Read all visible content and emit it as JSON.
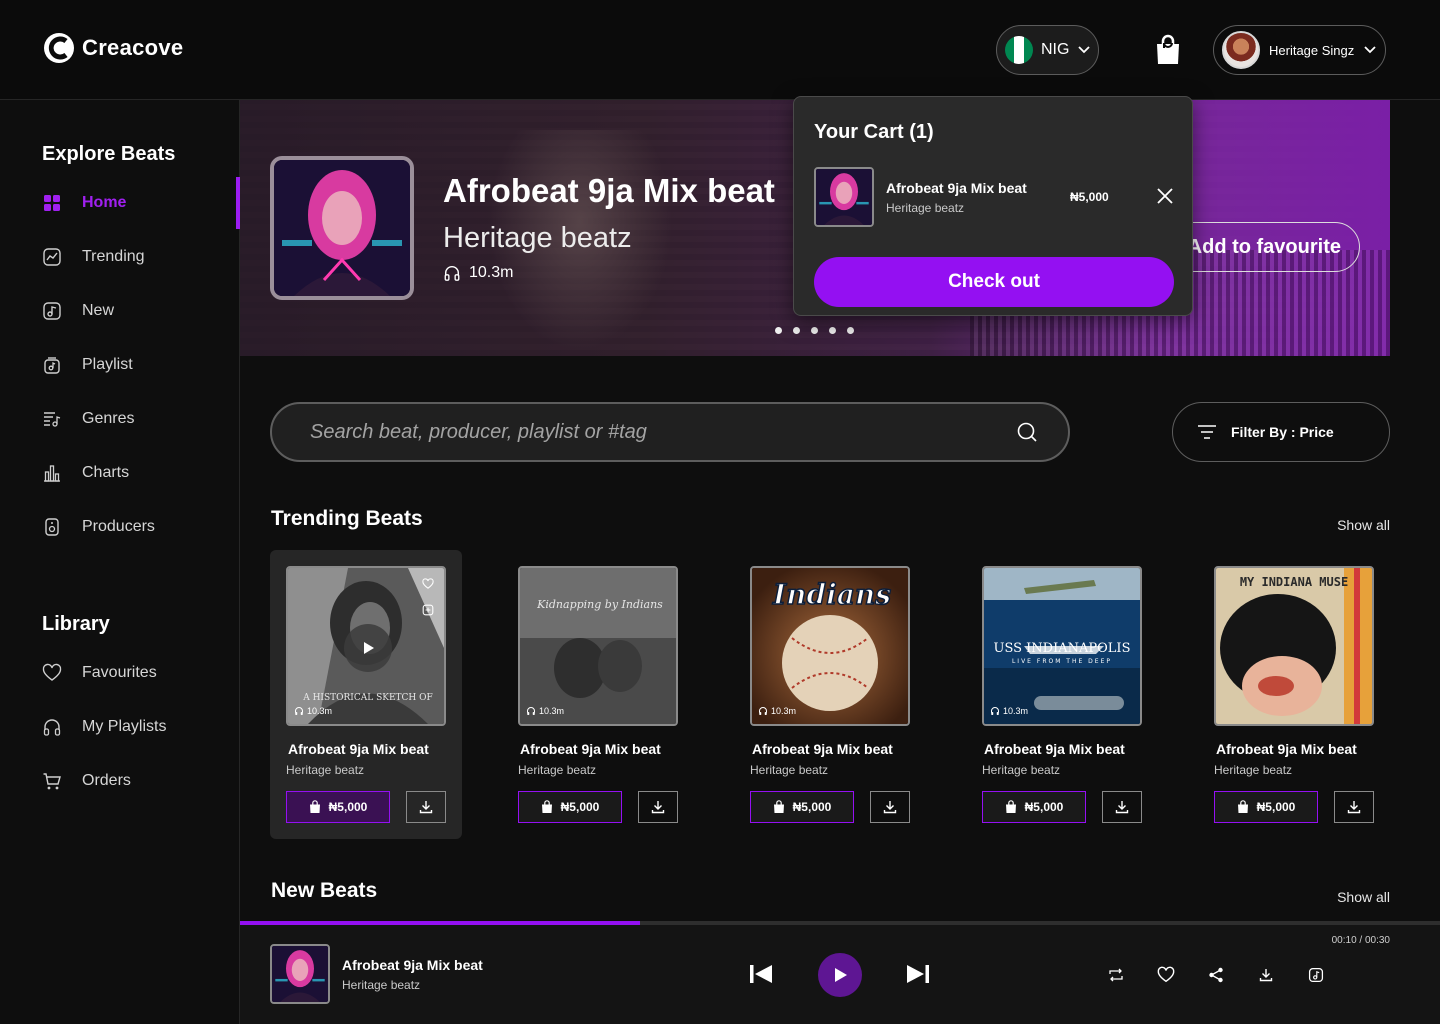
{
  "header": {
    "brand": "Creacove",
    "country": "NIG",
    "user_name": "Heritage Singz"
  },
  "sidebar": {
    "explore_title": "Explore Beats",
    "explore_items": [
      {
        "label": "Home",
        "icon": "grid-icon",
        "active": true
      },
      {
        "label": "Trending",
        "icon": "trending-icon"
      },
      {
        "label": "New",
        "icon": "music-note-icon"
      },
      {
        "label": "Playlist",
        "icon": "playlist-icon"
      },
      {
        "label": "Genres",
        "icon": "genres-icon"
      },
      {
        "label": "Charts",
        "icon": "bar-chart-icon"
      },
      {
        "label": "Producers",
        "icon": "speaker-icon"
      }
    ],
    "library_title": "Library",
    "library_items": [
      {
        "label": "Favourites",
        "icon": "heart-icon"
      },
      {
        "label": "My Playlists",
        "icon": "headphones-icon"
      },
      {
        "label": "Orders",
        "icon": "cart-icon"
      }
    ]
  },
  "hero": {
    "title": "Afrobeat 9ja Mix beat",
    "producer": "Heritage beatz",
    "plays": "10.3m",
    "favourite_label": "Add to favourite",
    "slides": 5
  },
  "cart": {
    "title": "Your Cart (1)",
    "item_title": "Afrobeat 9ja Mix beat",
    "item_producer": "Heritage beatz",
    "item_price": "₦5,000",
    "checkout_label": "Check out"
  },
  "search": {
    "placeholder": "Search beat, producer, playlist or #tag",
    "filter_label": "Filter By : Price"
  },
  "trending": {
    "title": "Trending Beats",
    "show_all": "Show all",
    "cards": [
      {
        "title": "Afrobeat 9ja Mix beat",
        "producer": "Heritage beatz",
        "price": "₦5,000",
        "plays": "10.3m",
        "cover_text": "A HISTORICAL SKETCH OF"
      },
      {
        "title": "Afrobeat 9ja Mix beat",
        "producer": "Heritage beatz",
        "price": "₦5,000",
        "plays": "10.3m",
        "cover_text": "Kidnapping by Indians"
      },
      {
        "title": "Afrobeat 9ja Mix beat",
        "producer": "Heritage beatz",
        "price": "₦5,000",
        "plays": "10.3m",
        "cover_text": "Indians"
      },
      {
        "title": "Afrobeat 9ja Mix beat",
        "producer": "Heritage beatz",
        "price": "₦5,000",
        "plays": "10.3m",
        "cover_text": "USS INDIANAPOLIS",
        "cover_sub": "LIVE FROM THE DEEP"
      },
      {
        "title": "Afrobeat 9ja Mix beat",
        "producer": "Heritage beatz",
        "price": "₦5,000",
        "plays": "",
        "cover_text": "MY INDIANA MUSE"
      }
    ]
  },
  "new_beats": {
    "title": "New Beats",
    "show_all": "Show all"
  },
  "player": {
    "title": "Afrobeat 9ja Mix beat",
    "producer": "Heritage beatz",
    "time": "00:10 / 00:30",
    "progress": 0.333
  },
  "colors": {
    "accent": "#9410f2",
    "background": "#0e0e0e"
  }
}
